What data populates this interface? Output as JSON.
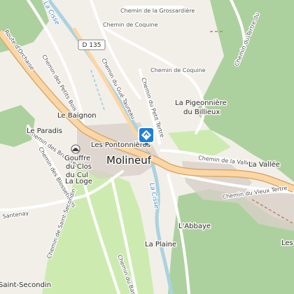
{
  "map": {
    "town": "Molineuf",
    "places": [
      "Les Pontonnières",
      "Le Baignon",
      "Le Paradis",
      "Gouffre du Clos du Cul",
      "La Loge",
      "La Pigeonnière du Billieux",
      "La Vallée",
      "L'Abbaye",
      "La Plaine",
      "Saint-Secondin",
      "Les"
    ],
    "streets": [
      "Chemin de la Grossardière",
      "Chemin de Coquine",
      "Chemin de Coquine",
      "Chemin du Tertre du",
      "Route d'Orchaise",
      "Chemin des Petits Bois",
      "Chemin du Gué Taureau",
      "Chemin du Petit Tertre",
      "Chemin des Bruyères",
      "Chemin des Blossetières",
      "Chemin de la Vallée",
      "Chemin du Vieux Tertre",
      "Santenay",
      "Chemin de Saint-Secondin",
      "Chemin du Bas"
    ],
    "river": [
      "La Cisse",
      "La Cisse"
    ],
    "road_shield": "D 135",
    "icons": [
      "location-marker-icon",
      "cave-icon"
    ],
    "colors": {
      "background": "#f2efe9",
      "forest": "#add19e",
      "field": "#cdebb0",
      "water": "#aad3df",
      "main_road": "#fcd6a4",
      "road_casing": "#d9a96a",
      "minor_road": "#ffffff",
      "built": "#d9d0c9",
      "marker": "#1e7fd6"
    }
  }
}
